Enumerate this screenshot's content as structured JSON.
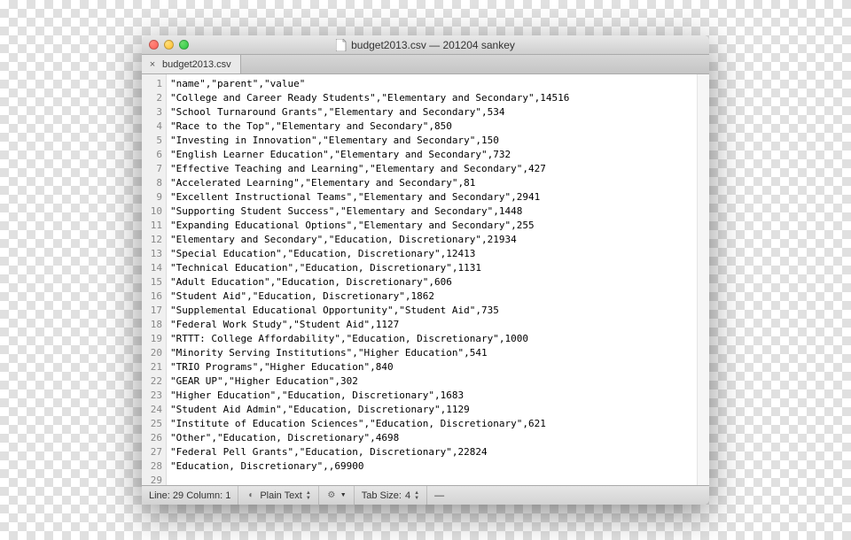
{
  "window": {
    "title": "budget2013.csv — 201204 sankey"
  },
  "tab": {
    "label": "budget2013.csv"
  },
  "lines": [
    "\"name\",\"parent\",\"value\"",
    "\"College and Career Ready Students\",\"Elementary and Secondary\",14516",
    "\"School Turnaround Grants\",\"Elementary and Secondary\",534",
    "\"Race to the Top\",\"Elementary and Secondary\",850",
    "\"Investing in Innovation\",\"Elementary and Secondary\",150",
    "\"English Learner Education\",\"Elementary and Secondary\",732",
    "\"Effective Teaching and Learning\",\"Elementary and Secondary\",427",
    "\"Accelerated Learning\",\"Elementary and Secondary\",81",
    "\"Excellent Instructional Teams\",\"Elementary and Secondary\",2941",
    "\"Supporting Student Success\",\"Elementary and Secondary\",1448",
    "\"Expanding Educational Options\",\"Elementary and Secondary\",255",
    "\"Elementary and Secondary\",\"Education, Discretionary\",21934",
    "\"Special Education\",\"Education, Discretionary\",12413",
    "\"Technical Education\",\"Education, Discretionary\",1131",
    "\"Adult Education\",\"Education, Discretionary\",606",
    "\"Student Aid\",\"Education, Discretionary\",1862",
    "\"Supplemental Educational Opportunity\",\"Student Aid\",735",
    "\"Federal Work Study\",\"Student Aid\",1127",
    "\"RTTT: College Affordability\",\"Education, Discretionary\",1000",
    "\"Minority Serving Institutions\",\"Higher Education\",541",
    "\"TRIO Programs\",\"Higher Education\",840",
    "\"GEAR UP\",\"Higher Education\",302",
    "\"Higher Education\",\"Education, Discretionary\",1683",
    "\"Student Aid Admin\",\"Education, Discretionary\",1129",
    "\"Institute of Education Sciences\",\"Education, Discretionary\",621",
    "\"Other\",\"Education, Discretionary\",4698",
    "\"Federal Pell Grants\",\"Education, Discretionary\",22824",
    "\"Education, Discretionary\",,69900",
    ""
  ],
  "status": {
    "line_col": "Line: 29   Column: 1",
    "syntax": "Plain Text",
    "tab_size_label": "Tab Size:",
    "tab_size_value": "4",
    "extra": "—"
  }
}
